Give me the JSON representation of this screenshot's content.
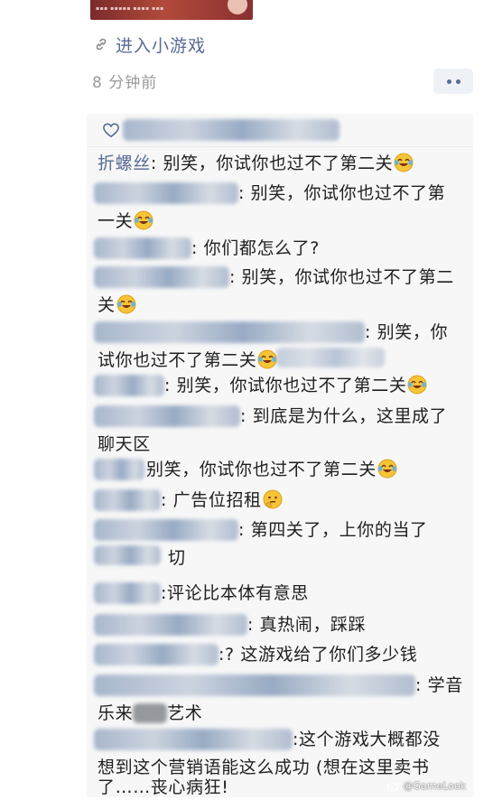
{
  "post": {
    "mini_game_link": "进入小游戏",
    "timestamp": "8 分钟前"
  },
  "comments": [
    {
      "name": "折螺丝",
      "separator": ":",
      "line1": "别笑，你试你也过不了第二关",
      "emoji": "laughing-crying-emoji"
    },
    {
      "separator": ":",
      "line1": "别笑，你试你也过不了第",
      "line2": "一关",
      "emoji": "laughing-crying-emoji"
    },
    {
      "separator": ":",
      "line1": "你们都怎么了?"
    },
    {
      "separator": ":",
      "line1": "别笑，你试你也过不了第二",
      "line2": "关",
      "emoji": "laughing-crying-emoji"
    },
    {
      "separator": ":",
      "line1": "别笑，你",
      "line2": "试你也过不了第二关",
      "emoji": "laughing-crying-emoji"
    },
    {
      "separator": ":",
      "line1": "别笑，你试你也过不了第二关",
      "emoji": "laughing-crying-emoji"
    },
    {
      "separator": ":",
      "line1": "到底是为什么，这里成了",
      "line2": "聊天区"
    },
    {
      "line1": "别笑，你试你也过不了第二关",
      "emoji": "laughing-crying-emoji"
    },
    {
      "separator": ":",
      "line1": "广告位招租",
      "emoji": "thinking-emoji"
    },
    {
      "separator": ":",
      "line1": "第四关了，上你的当了",
      "line2": "切"
    },
    {
      "separator": ":",
      "line1": "评论比本体有意思"
    },
    {
      "separator": ":",
      "line1": "真热闹，踩踩"
    },
    {
      "separator": ":",
      "line1": "? 这游戏给了你们多少钱"
    },
    {
      "separator": ":",
      "line1": "学音",
      "line2_pre": "乐来",
      "line2_post": "艺术"
    },
    {
      "separator": ":",
      "line1": "这个游戏大概都没",
      "line2": "想到这个营销语能这么成功 (想在这里卖书",
      "line3": "了……丧心病狂!"
    }
  ],
  "watermark": "@GameLook",
  "colors": {
    "link": "#576b95",
    "panel": "#f7f7f7",
    "time": "#9a9a9a"
  }
}
